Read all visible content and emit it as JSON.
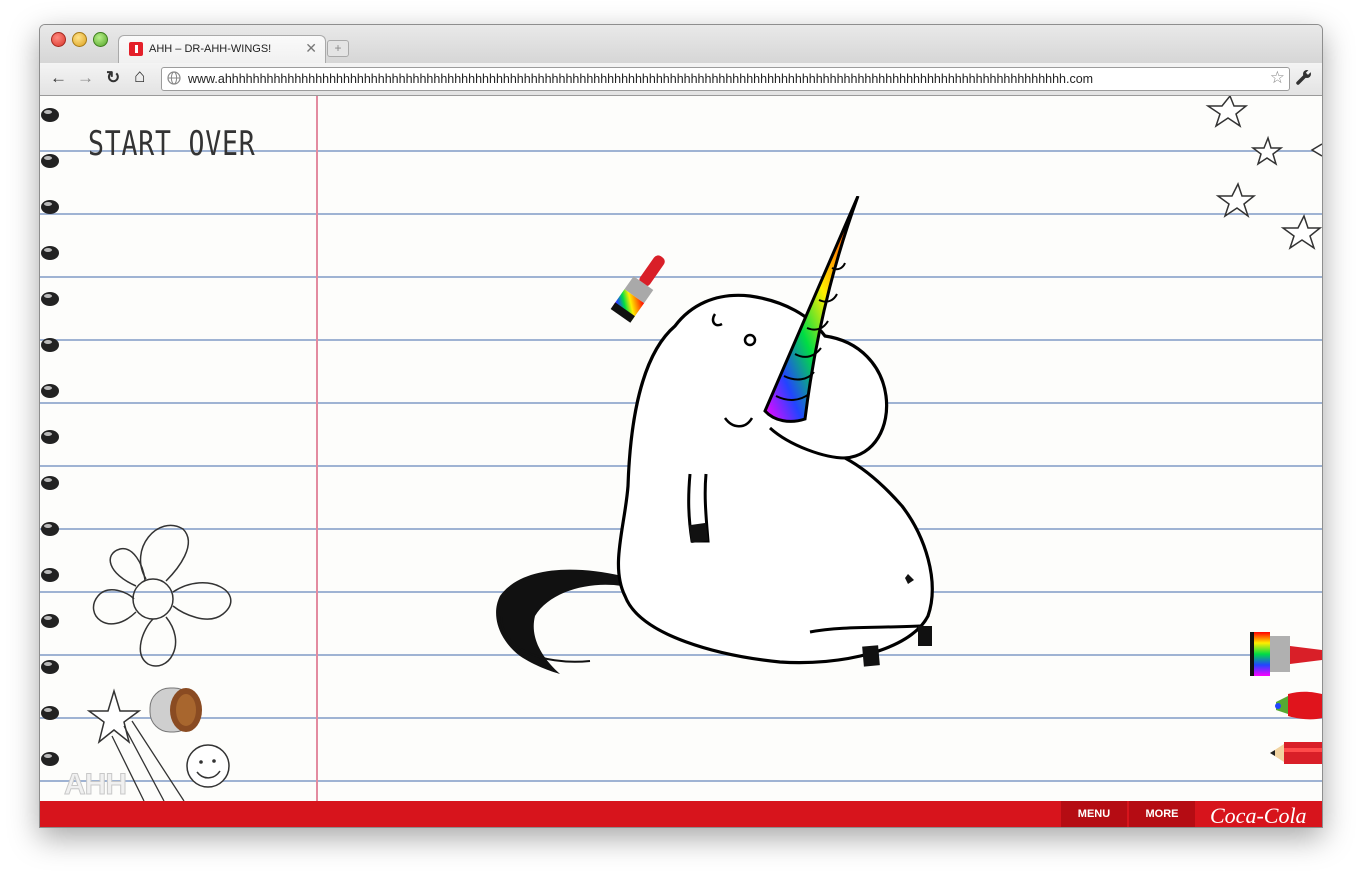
{
  "browser": {
    "tab_title": "AHH – DR-AHH-WINGS!",
    "tab_close": "✕",
    "new_tab": "+",
    "url": "www.ahhhhhhhhhhhhhhhhhhhhhhhhhhhhhhhhhhhhhhhhhhhhhhhhhhhhhhhhhhhhhhhhhhhhhhhhhhhhhhhhhhhhhhhhhhhhhhhhhhhhhhhhhhhhhhhhhhhhhhhhh.com",
    "back_glyph": "←",
    "forward_glyph": "→",
    "reload_glyph": "↻",
    "home_glyph": "⌂",
    "bookmark_glyph": "☆"
  },
  "page": {
    "start_over_label": "START OVER",
    "brand_logo": "AHH",
    "footer": {
      "menu_label": "MENU",
      "more_label": "MORE",
      "coke_logo": "Coca-Cola"
    }
  },
  "icons": {
    "tools": [
      "paintbrush-icon",
      "paint-tube-icon",
      "pencil-icon"
    ],
    "decor": [
      "flower-doodle",
      "smiley-doodle",
      "star-doodle",
      "eraser-icon"
    ]
  },
  "colors": {
    "footer_red": "#d7141c",
    "footer_button": "#b50c13",
    "margin_line": "#e38ba0",
    "ruled_line": "#9fb3d3"
  }
}
